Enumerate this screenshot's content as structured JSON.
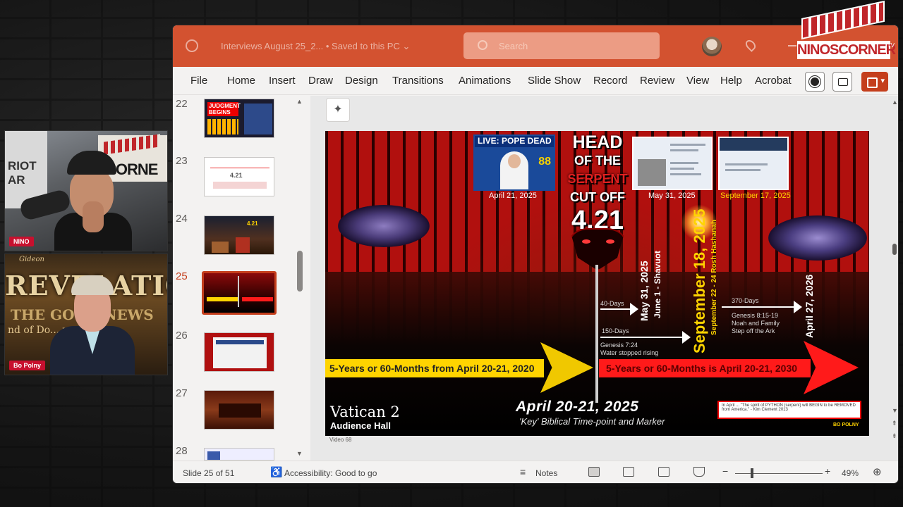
{
  "overlay": {
    "logo": "NINOSCORNER",
    "logo_tm": "TV"
  },
  "cams": [
    {
      "name": "NINO",
      "poster": "RIOT AR",
      "sign": "CORNE"
    },
    {
      "name": "Bo Polny",
      "small": "Gideon",
      "line1": "REVELATIO",
      "line2": "THE GOOD NEWS",
      "line3": "nd of Do... veal"
    }
  ],
  "window": {
    "title": "Interviews August 25_2... • Saved to this PC ⌄",
    "search_placeholder": "Search",
    "accent": "#d35230"
  },
  "ribbon": {
    "menus": [
      "File",
      "Home",
      "Insert",
      "Draw",
      "Design",
      "Transitions",
      "Animations",
      "Slide Show",
      "Record",
      "Review",
      "View",
      "Help",
      "Acrobat"
    ]
  },
  "thumbnails": [
    {
      "num": "22",
      "thumb_text": "JUDGMENT BEGINS"
    },
    {
      "num": "23",
      "thumb_text": "4.21"
    },
    {
      "num": "24",
      "thumb_text": "4.21"
    },
    {
      "num": "25",
      "thumb_text": ""
    },
    {
      "num": "26",
      "thumb_text": ""
    },
    {
      "num": "27",
      "thumb_text": ""
    },
    {
      "num": "28",
      "thumb_text": ""
    }
  ],
  "slide": {
    "pope_header": "LIVE: POPE DEAD",
    "pope_number": "88",
    "pope_date": "April 21, 2025",
    "biden_date": "May 31, 2025",
    "news_date": "September 17, 2025",
    "head_line1": "HEAD",
    "head_line2": "OF THE",
    "head_line3": "SERPENT",
    "head_line4": "CUT OFF",
    "head_line5": "4.21",
    "vert_may": "May 31, 2025",
    "vert_june": "June 1 - Shavuot",
    "vert_sept": "September 18, 2025",
    "vert_sept_sub": "September 22 - 24 Rosh Hashanah",
    "vert_april": "April 27, 2026",
    "days40": "40-Days",
    "days150": "150-Days",
    "days370": "370-Days",
    "genesis1": "Genesis 7:24",
    "genesis1b": "Water stopped rising",
    "genesis2": "Genesis 8:15-19",
    "genesis2b": "Noah and Family",
    "genesis2c": "Step off the Ark",
    "arrow_left_text": "5-Years or 60-Months from April 20-21, 2020",
    "arrow_right_text": "5-Years or 60-Months is April 20-21, 2030",
    "bottom_date": "April 20-21, 2025",
    "bottom_sub": "'Key' Biblical Time-point and Marker",
    "vatican": "Vatican 2",
    "vatican_sub": "Audience Hall",
    "quote": "In April ... \"The spirit of PYTHON (serpent) will BEGIN to be REMOVED from America.\" - Kim Clement 2013",
    "logo_small": "BO POLNY",
    "video_label": "Video 68"
  },
  "status": {
    "slide": "Slide 25 of 51",
    "accessibility": "Accessibility: Good to go",
    "notes": "Notes",
    "zoom": "49%"
  }
}
